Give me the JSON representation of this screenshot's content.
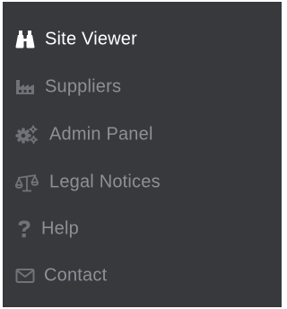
{
  "colors": {
    "panel_background": "#37393d",
    "active_text": "#ffffff",
    "inactive_text": "#8d9096",
    "inactive_icon": "#6f7277"
  },
  "menu": {
    "items": [
      {
        "label": "Site Viewer",
        "icon": "binoculars-icon",
        "active": true
      },
      {
        "label": "Suppliers",
        "icon": "industry-icon",
        "active": false
      },
      {
        "label": "Admin Panel",
        "icon": "cogs-icon",
        "active": false
      },
      {
        "label": "Legal Notices",
        "icon": "balance-scale-icon",
        "active": false
      },
      {
        "label": "Help",
        "icon": "question-icon",
        "active": false
      },
      {
        "label": "Contact",
        "icon": "envelope-icon",
        "active": false
      }
    ]
  }
}
